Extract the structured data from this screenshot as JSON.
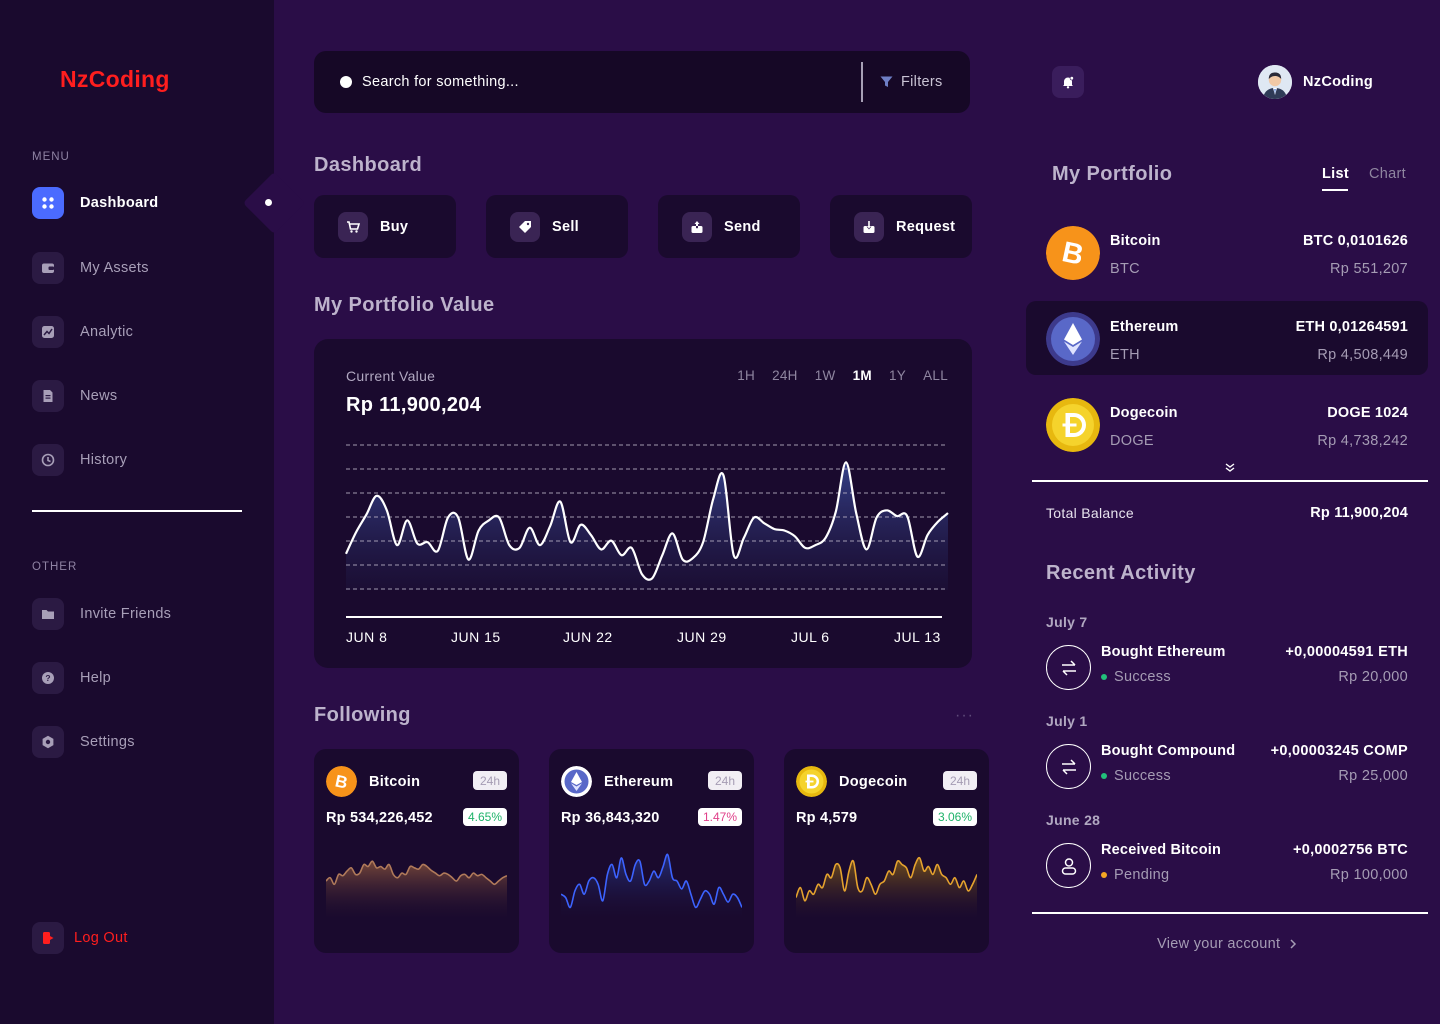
{
  "brand": {
    "logo": "NzCoding"
  },
  "sidebar": {
    "menu_heading": "MENU",
    "items": [
      {
        "label": "Dashboard",
        "icon": "grid-icon"
      },
      {
        "label": "My Assets",
        "icon": "wallet-icon"
      },
      {
        "label": "Analytic",
        "icon": "analytics-icon"
      },
      {
        "label": "News",
        "icon": "document-icon"
      },
      {
        "label": "History",
        "icon": "clock-icon"
      }
    ],
    "other_heading": "OTHER",
    "other_items": [
      {
        "label": "Invite Friends",
        "icon": "folder-icon"
      },
      {
        "label": "Help",
        "icon": "help-icon"
      },
      {
        "label": "Settings",
        "icon": "gear-icon"
      }
    ],
    "logout": "Log Out"
  },
  "search": {
    "placeholder": "Search for something...",
    "filters": "Filters"
  },
  "user": {
    "name": "NzCoding"
  },
  "dashboard": {
    "title": "Dashboard",
    "actions": [
      "Buy",
      "Sell",
      "Send",
      "Request"
    ]
  },
  "portfolio_value": {
    "title": "My Portfolio Value",
    "current_label": "Current Value",
    "current_value": "Rp 11,900,204",
    "ranges": [
      "1H",
      "24H",
      "1W",
      "1M",
      "1Y",
      "ALL"
    ],
    "active_range": "1M"
  },
  "chart_data": {
    "type": "area",
    "x_labels": [
      "JUN 8",
      "JUN 15",
      "JUN 22",
      "JUN 29",
      "JUL 6",
      "JUL 13"
    ],
    "y_relative": [
      0.25,
      0.4,
      0.52,
      0.65,
      0.55,
      0.31,
      0.48,
      0.32,
      0.33,
      0.27,
      0.5,
      0.5,
      0.21,
      0.41,
      0.48,
      0.5,
      0.31,
      0.29,
      0.43,
      0.31,
      0.44,
      0.61,
      0.33,
      0.45,
      0.38,
      0.28,
      0.34,
      0.24,
      0.29,
      0.11,
      0.08,
      0.24,
      0.39,
      0.21,
      0.22,
      0.33,
      0.63,
      0.79,
      0.24,
      0.36,
      0.5,
      0.46,
      0.42,
      0.41,
      0.37,
      0.29,
      0.31,
      0.36,
      0.54,
      0.88,
      0.53,
      0.28,
      0.5,
      0.55,
      0.51,
      0.51,
      0.23,
      0.38,
      0.47,
      0.53
    ]
  },
  "following": {
    "title": "Following",
    "cards": [
      {
        "name": "Bitcoin",
        "period": "24h",
        "price": "Rp 534,226,452",
        "change": "4.65%",
        "change_color": "#1fb36a",
        "line_color": "#b07a5a",
        "fill_color": "#7a4a3a",
        "spark": [
          0.5,
          0.55,
          0.45,
          0.6,
          0.58,
          0.65,
          0.7,
          0.6,
          0.62,
          0.75,
          0.72,
          0.8,
          0.7,
          0.72,
          0.68,
          0.75,
          0.6,
          0.55,
          0.62,
          0.6,
          0.72,
          0.7,
          0.68,
          0.75,
          0.72,
          0.66,
          0.62,
          0.58,
          0.62,
          0.6,
          0.55,
          0.5,
          0.58,
          0.6,
          0.55,
          0.62,
          0.58,
          0.6,
          0.55,
          0.5,
          0.45,
          0.5,
          0.55,
          0.58
        ]
      },
      {
        "name": "Ethereum",
        "period": "24h",
        "price": "Rp 36,843,320",
        "change": "1.47%",
        "change_color": "#e0408a",
        "line_color": "#3c63ff",
        "fill_color": "#25307a",
        "spark": [
          0.3,
          0.25,
          0.1,
          0.35,
          0.45,
          0.3,
          0.5,
          0.55,
          0.45,
          0.2,
          0.6,
          0.75,
          0.55,
          0.85,
          0.6,
          0.5,
          0.75,
          0.8,
          0.45,
          0.5,
          0.65,
          0.55,
          0.72,
          0.9,
          0.55,
          0.5,
          0.38,
          0.5,
          0.3,
          0.1,
          0.22,
          0.35,
          0.3,
          0.15,
          0.4,
          0.3,
          0.18,
          0.3,
          0.25,
          0.1
        ]
      },
      {
        "name": "Dogecoin",
        "period": "24h",
        "price": "Rp 4,579",
        "change": "3.06%",
        "change_color": "#1fb36a",
        "line_color": "#e4a22e",
        "fill_color": "#7a5518",
        "spark": [
          0.25,
          0.4,
          0.2,
          0.35,
          0.3,
          0.45,
          0.4,
          0.6,
          0.55,
          0.75,
          0.7,
          0.35,
          0.65,
          0.8,
          0.4,
          0.35,
          0.55,
          0.45,
          0.3,
          0.45,
          0.5,
          0.65,
          0.6,
          0.8,
          0.75,
          0.7,
          0.55,
          0.75,
          0.85,
          0.65,
          0.72,
          0.6,
          0.75,
          0.6,
          0.55,
          0.45,
          0.55,
          0.4,
          0.5,
          0.35,
          0.45,
          0.6
        ]
      }
    ]
  },
  "my_portfolio": {
    "title": "My Portfolio",
    "tabs": [
      "List",
      "Chart"
    ],
    "assets": [
      {
        "name": "Bitcoin",
        "symbol": "BTC",
        "amount": "BTC 0,0101626",
        "value": "Rp 551,207"
      },
      {
        "name": "Ethereum",
        "symbol": "ETH",
        "amount": "ETH 0,01264591",
        "value": "Rp 4,508,449"
      },
      {
        "name": "Dogecoin",
        "symbol": "DOGE",
        "amount": "DOGE  1024",
        "value": "Rp 4,738,242"
      }
    ],
    "total_label": "Total Balance",
    "total_value": "Rp 11,900,204"
  },
  "recent_activity": {
    "title": "Recent Activity",
    "items": [
      {
        "date": "July 7",
        "title": "Bought Ethereum",
        "status": "Success",
        "status_color": "#22c07b",
        "amount": "+0,00004591 ETH",
        "value": "Rp 20,000"
      },
      {
        "date": "July 1",
        "title": "Bought Compound",
        "status": "Success",
        "status_color": "#22c07b",
        "amount": "+0,00003245 COMP",
        "value": "Rp 25,000"
      },
      {
        "date": "June 28",
        "title": "Received Bitcoin",
        "status": "Pending",
        "status_color": "#f5a623",
        "amount": "+0,0002756 BTC",
        "value": "Rp 100,000"
      }
    ],
    "view_account": "View your account"
  },
  "colors": {
    "background": "#2a0d47",
    "sidebar": "#1a0a2e",
    "card": "#1a0a2e",
    "accent_blue": "#4b6bff",
    "brand_red": "#ff1e1e"
  }
}
